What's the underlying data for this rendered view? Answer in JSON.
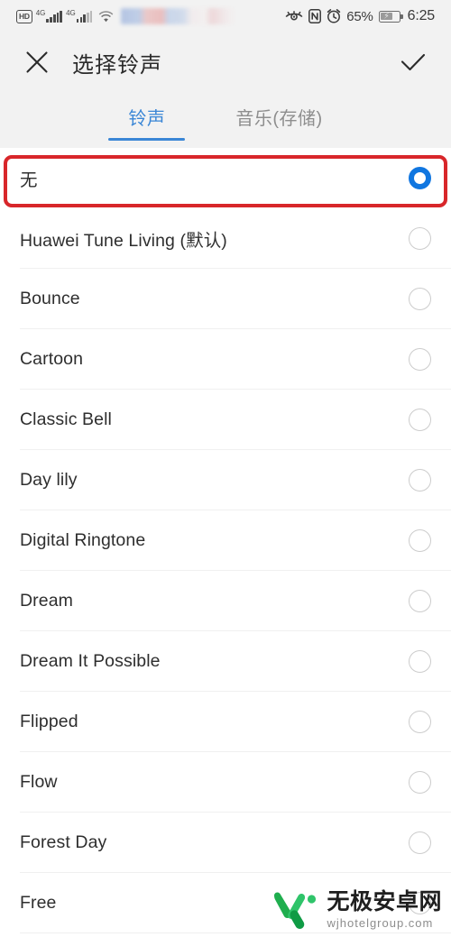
{
  "status_bar": {
    "hd_label": "HD",
    "sim1_net": "4G",
    "sim2_net": "4G",
    "wifi_icon": "wifi-icon",
    "carrier_blurred": "",
    "eye_icon": "eye-comfort-icon",
    "nfc_icon": "nfc-icon",
    "alarm_icon": "alarm-icon",
    "battery_percent": "65%",
    "battery_charging_icon": "charging-bolt-icon",
    "time": "6:25"
  },
  "app_bar": {
    "close_icon": "close-icon",
    "title": "选择铃声",
    "confirm_icon": "check-icon"
  },
  "tabs": [
    {
      "label": "铃声",
      "active": true
    },
    {
      "label": "音乐(存储)",
      "active": false
    }
  ],
  "ringtones": [
    {
      "label": "无",
      "selected": true,
      "cjk": true
    },
    {
      "label": "Huawei Tune Living (默认)",
      "selected": false,
      "cjk": false
    },
    {
      "label": "Bounce",
      "selected": false,
      "cjk": false
    },
    {
      "label": "Cartoon",
      "selected": false,
      "cjk": false
    },
    {
      "label": "Classic Bell",
      "selected": false,
      "cjk": false
    },
    {
      "label": "Day lily",
      "selected": false,
      "cjk": false
    },
    {
      "label": "Digital Ringtone",
      "selected": false,
      "cjk": false
    },
    {
      "label": "Dream",
      "selected": false,
      "cjk": false
    },
    {
      "label": "Dream It Possible",
      "selected": false,
      "cjk": false
    },
    {
      "label": "Flipped",
      "selected": false,
      "cjk": false
    },
    {
      "label": "Flow",
      "selected": false,
      "cjk": false
    },
    {
      "label": "Forest Day",
      "selected": false,
      "cjk": false
    },
    {
      "label": "Free",
      "selected": false,
      "cjk": false
    }
  ],
  "annotation": {
    "highlight_color": "#d8262a",
    "target": "无"
  },
  "watermark": {
    "logo_icon": "w-logo-icon",
    "site_name": "无极安卓网",
    "site_url": "wjhotelgroup.com",
    "logo_color": "#17a84a"
  },
  "colors": {
    "accent": "#1076e0",
    "tab_active": "#3a86d6",
    "chrome_bg": "#f2f2f2",
    "list_bg": "#ffffff",
    "divider": "#f0f0f0",
    "text_primary": "#2e2e2e",
    "text_muted": "#8e8e8e"
  }
}
